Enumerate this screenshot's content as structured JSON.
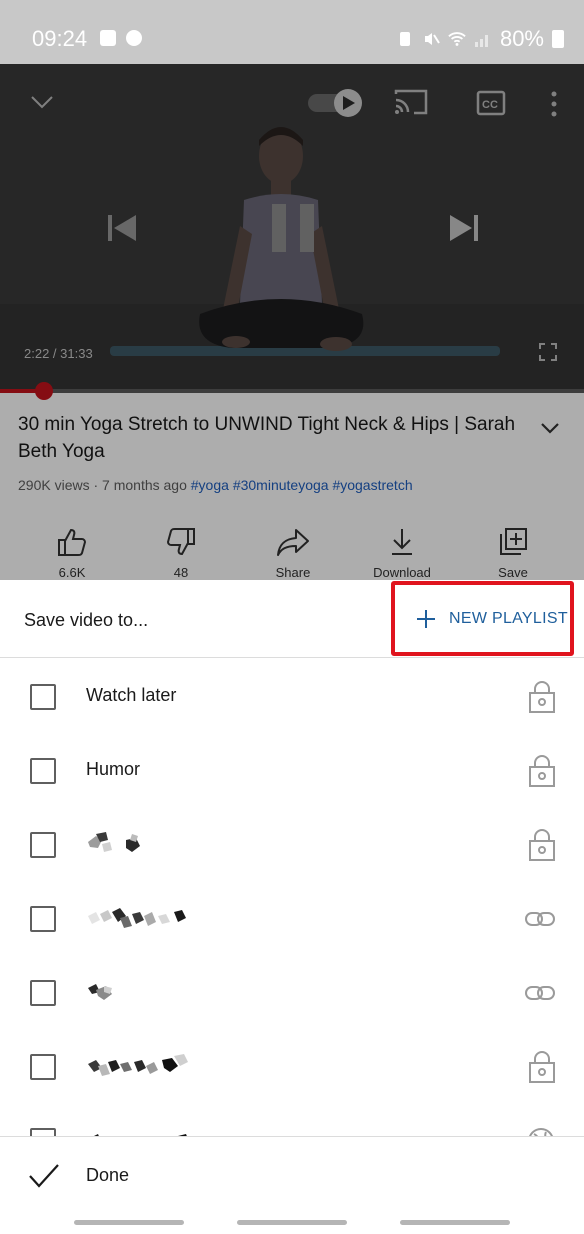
{
  "status_bar": {
    "time": "09:24",
    "left_icons": [
      "gallery-icon",
      "facebook-icon"
    ],
    "right_icons": [
      "battery-saver-icon",
      "mute-icon",
      "wifi-icon",
      "signal-icon"
    ],
    "battery": "80%"
  },
  "player": {
    "time_readout": "2:22 / 31:33",
    "progress": 0.075,
    "controls": [
      "minimize-chevron-icon",
      "autoplay-toggle",
      "cast-icon",
      "captions-icon",
      "more-vert-icon",
      "previous-icon",
      "pause-icon",
      "next-icon",
      "fullscreen-icon"
    ]
  },
  "video": {
    "title": "30 min Yoga Stretch to UNWIND Tight Neck & Hips | Sarah Beth Yoga",
    "meta": "290K views · 7 months ago",
    "tags": [
      "#yoga",
      "#30minuteyoga",
      "#yogastretch"
    ],
    "actions": [
      {
        "label": "6.6K",
        "icon": "thumb-up-icon"
      },
      {
        "label": "48",
        "icon": "thumb-down-icon"
      },
      {
        "label": "Share",
        "icon": "share-icon"
      },
      {
        "label": "Download",
        "icon": "download-icon"
      },
      {
        "label": "Save",
        "icon": "save-playlist-icon"
      }
    ]
  },
  "sheet": {
    "title": "Save video to...",
    "new_playlist_label": "NEW PLAYLIST",
    "highlight_color": "#e0141e",
    "playlists": [
      {
        "name": "Watch later",
        "privacy": "lock-icon"
      },
      {
        "name": "Humor",
        "privacy": "lock-icon"
      },
      {
        "name": "",
        "privacy": "lock-icon"
      },
      {
        "name": "",
        "privacy": "link-icon"
      },
      {
        "name": "",
        "privacy": "link-icon"
      },
      {
        "name": "",
        "privacy": "lock-icon"
      },
      {
        "name": "",
        "privacy": "globe-icon"
      }
    ],
    "done_label": "Done"
  }
}
